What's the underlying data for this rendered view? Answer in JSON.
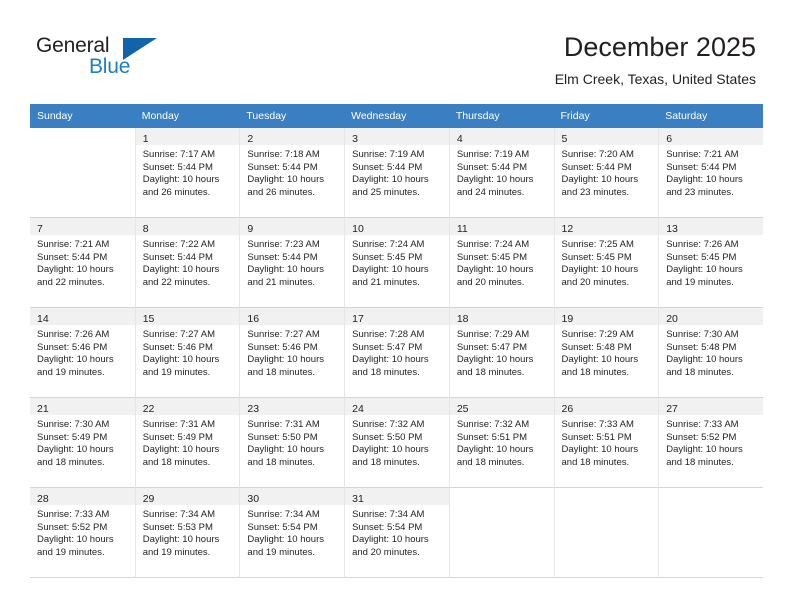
{
  "brand": {
    "name_part1": "General",
    "name_part2": "Blue",
    "logo_icon": "triangle-icon"
  },
  "header": {
    "month_title": "December 2025",
    "location": "Elm Creek, Texas, United States"
  },
  "calendar": {
    "weekday_headers": [
      "Sunday",
      "Monday",
      "Tuesday",
      "Wednesday",
      "Thursday",
      "Friday",
      "Saturday"
    ],
    "header_bg": "#3a7fc1",
    "daynum_bg": "#f1f1f1",
    "weeks": [
      [
        {
          "day": "",
          "lines": []
        },
        {
          "day": "1",
          "lines": [
            "Sunrise: 7:17 AM",
            "Sunset: 5:44 PM",
            "Daylight: 10 hours",
            "and 26 minutes."
          ]
        },
        {
          "day": "2",
          "lines": [
            "Sunrise: 7:18 AM",
            "Sunset: 5:44 PM",
            "Daylight: 10 hours",
            "and 26 minutes."
          ]
        },
        {
          "day": "3",
          "lines": [
            "Sunrise: 7:19 AM",
            "Sunset: 5:44 PM",
            "Daylight: 10 hours",
            "and 25 minutes."
          ]
        },
        {
          "day": "4",
          "lines": [
            "Sunrise: 7:19 AM",
            "Sunset: 5:44 PM",
            "Daylight: 10 hours",
            "and 24 minutes."
          ]
        },
        {
          "day": "5",
          "lines": [
            "Sunrise: 7:20 AM",
            "Sunset: 5:44 PM",
            "Daylight: 10 hours",
            "and 23 minutes."
          ]
        },
        {
          "day": "6",
          "lines": [
            "Sunrise: 7:21 AM",
            "Sunset: 5:44 PM",
            "Daylight: 10 hours",
            "and 23 minutes."
          ]
        }
      ],
      [
        {
          "day": "7",
          "lines": [
            "Sunrise: 7:21 AM",
            "Sunset: 5:44 PM",
            "Daylight: 10 hours",
            "and 22 minutes."
          ]
        },
        {
          "day": "8",
          "lines": [
            "Sunrise: 7:22 AM",
            "Sunset: 5:44 PM",
            "Daylight: 10 hours",
            "and 22 minutes."
          ]
        },
        {
          "day": "9",
          "lines": [
            "Sunrise: 7:23 AM",
            "Sunset: 5:44 PM",
            "Daylight: 10 hours",
            "and 21 minutes."
          ]
        },
        {
          "day": "10",
          "lines": [
            "Sunrise: 7:24 AM",
            "Sunset: 5:45 PM",
            "Daylight: 10 hours",
            "and 21 minutes."
          ]
        },
        {
          "day": "11",
          "lines": [
            "Sunrise: 7:24 AM",
            "Sunset: 5:45 PM",
            "Daylight: 10 hours",
            "and 20 minutes."
          ]
        },
        {
          "day": "12",
          "lines": [
            "Sunrise: 7:25 AM",
            "Sunset: 5:45 PM",
            "Daylight: 10 hours",
            "and 20 minutes."
          ]
        },
        {
          "day": "13",
          "lines": [
            "Sunrise: 7:26 AM",
            "Sunset: 5:45 PM",
            "Daylight: 10 hours",
            "and 19 minutes."
          ]
        }
      ],
      [
        {
          "day": "14",
          "lines": [
            "Sunrise: 7:26 AM",
            "Sunset: 5:46 PM",
            "Daylight: 10 hours",
            "and 19 minutes."
          ]
        },
        {
          "day": "15",
          "lines": [
            "Sunrise: 7:27 AM",
            "Sunset: 5:46 PM",
            "Daylight: 10 hours",
            "and 19 minutes."
          ]
        },
        {
          "day": "16",
          "lines": [
            "Sunrise: 7:27 AM",
            "Sunset: 5:46 PM",
            "Daylight: 10 hours",
            "and 18 minutes."
          ]
        },
        {
          "day": "17",
          "lines": [
            "Sunrise: 7:28 AM",
            "Sunset: 5:47 PM",
            "Daylight: 10 hours",
            "and 18 minutes."
          ]
        },
        {
          "day": "18",
          "lines": [
            "Sunrise: 7:29 AM",
            "Sunset: 5:47 PM",
            "Daylight: 10 hours",
            "and 18 minutes."
          ]
        },
        {
          "day": "19",
          "lines": [
            "Sunrise: 7:29 AM",
            "Sunset: 5:48 PM",
            "Daylight: 10 hours",
            "and 18 minutes."
          ]
        },
        {
          "day": "20",
          "lines": [
            "Sunrise: 7:30 AM",
            "Sunset: 5:48 PM",
            "Daylight: 10 hours",
            "and 18 minutes."
          ]
        }
      ],
      [
        {
          "day": "21",
          "lines": [
            "Sunrise: 7:30 AM",
            "Sunset: 5:49 PM",
            "Daylight: 10 hours",
            "and 18 minutes."
          ]
        },
        {
          "day": "22",
          "lines": [
            "Sunrise: 7:31 AM",
            "Sunset: 5:49 PM",
            "Daylight: 10 hours",
            "and 18 minutes."
          ]
        },
        {
          "day": "23",
          "lines": [
            "Sunrise: 7:31 AM",
            "Sunset: 5:50 PM",
            "Daylight: 10 hours",
            "and 18 minutes."
          ]
        },
        {
          "day": "24",
          "lines": [
            "Sunrise: 7:32 AM",
            "Sunset: 5:50 PM",
            "Daylight: 10 hours",
            "and 18 minutes."
          ]
        },
        {
          "day": "25",
          "lines": [
            "Sunrise: 7:32 AM",
            "Sunset: 5:51 PM",
            "Daylight: 10 hours",
            "and 18 minutes."
          ]
        },
        {
          "day": "26",
          "lines": [
            "Sunrise: 7:33 AM",
            "Sunset: 5:51 PM",
            "Daylight: 10 hours",
            "and 18 minutes."
          ]
        },
        {
          "day": "27",
          "lines": [
            "Sunrise: 7:33 AM",
            "Sunset: 5:52 PM",
            "Daylight: 10 hours",
            "and 18 minutes."
          ]
        }
      ],
      [
        {
          "day": "28",
          "lines": [
            "Sunrise: 7:33 AM",
            "Sunset: 5:52 PM",
            "Daylight: 10 hours",
            "and 19 minutes."
          ]
        },
        {
          "day": "29",
          "lines": [
            "Sunrise: 7:34 AM",
            "Sunset: 5:53 PM",
            "Daylight: 10 hours",
            "and 19 minutes."
          ]
        },
        {
          "day": "30",
          "lines": [
            "Sunrise: 7:34 AM",
            "Sunset: 5:54 PM",
            "Daylight: 10 hours",
            "and 19 minutes."
          ]
        },
        {
          "day": "31",
          "lines": [
            "Sunrise: 7:34 AM",
            "Sunset: 5:54 PM",
            "Daylight: 10 hours",
            "and 20 minutes."
          ]
        },
        {
          "day": "",
          "lines": []
        },
        {
          "day": "",
          "lines": []
        },
        {
          "day": "",
          "lines": []
        }
      ]
    ]
  }
}
